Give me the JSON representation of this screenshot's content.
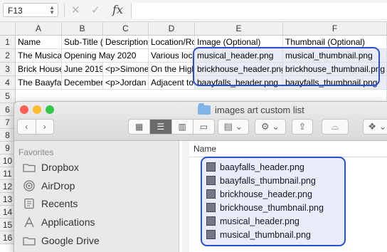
{
  "formula_bar": {
    "name_box": "F13",
    "cancel_icon": "x-icon",
    "confirm_icon": "check-icon",
    "fx_label": "fx",
    "formula": ""
  },
  "spreadsheet": {
    "columns": [
      "A",
      "B",
      "C",
      "D",
      "E",
      "F"
    ],
    "row_numbers": [
      "1",
      "2",
      "3",
      "4",
      "5",
      "6",
      "7",
      "8",
      "9",
      "10",
      "11",
      "12",
      "13",
      "14",
      "15",
      "16"
    ],
    "rows": [
      [
        "Name",
        "Sub-Title (i",
        "Description (",
        "Location/Roo",
        "Image (Optional)",
        "Thumbnail (Optional)"
      ],
      [
        "The Musical",
        "Opening May 2020",
        "",
        "Various loca",
        "musical_header.png",
        "musical_thumbnail.png"
      ],
      [
        "Brick House ,",
        "June 2019",
        "<p>Simone",
        "On the High",
        "brickhouse_header.png",
        "brickhouse_thumbnail.png"
      ],
      [
        "The Baayfall",
        "December",
        "<p>Jordan",
        "Adjacent to t",
        "baayfalls_header.png",
        "baayfalls_thumbnail.png"
      ]
    ],
    "highlight_color": "#e7ecf8",
    "callout_color": "#2a4fd1"
  },
  "finder": {
    "title": "images art custom list",
    "traffic_lights": [
      "#fc5f57",
      "#fdbc2e",
      "#34c84a"
    ],
    "nav": {
      "back": "‹",
      "forward": "›"
    },
    "sidebar_heading": "Favorites",
    "sidebar_items": [
      {
        "label": "Dropbox",
        "icon": "folder-icon"
      },
      {
        "label": "AirDrop",
        "icon": "airdrop-icon"
      },
      {
        "label": "Recents",
        "icon": "clock-icon"
      },
      {
        "label": "Applications",
        "icon": "applications-icon"
      },
      {
        "label": "Google Drive",
        "icon": "folder-icon"
      }
    ],
    "column_header": "Name",
    "files": [
      "baayfalls_header.png",
      "baayfalls_thumbnail.png",
      "brickhouse_header.png",
      "brickhouse_thumbnail.png",
      "musical_header.png",
      "musical_thumbnail.png"
    ]
  }
}
